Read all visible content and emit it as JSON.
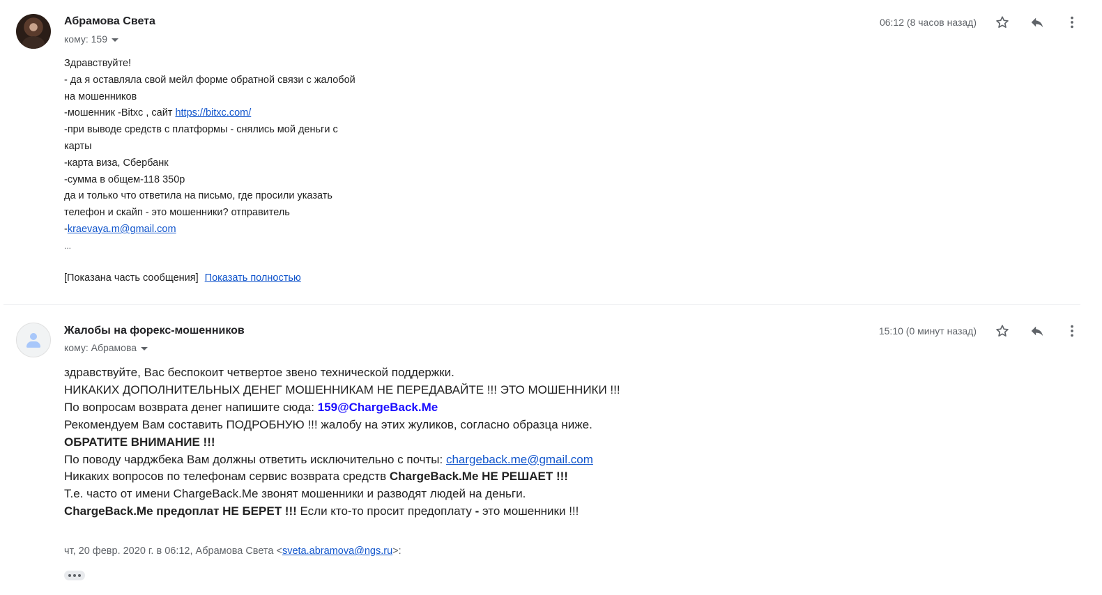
{
  "message1": {
    "sender": "Абрамова Света",
    "to": "кому: 159",
    "time": "06:12 (8 часов назад)",
    "body_lines": [
      "Здравствуйте!",
      "- да я оставляла свой мейл форме обратной связи с жалобой",
      "на мошенников"
    ],
    "fraud_prefix": "-мошенник -Bitxc , сайт ",
    "fraud_link": "https://bitxc.com/",
    "body_lines_2": [
      "-при выводе средств с платформы - снялись мой деньги с",
      "карты",
      "-карта виза, Сбербанк",
      "-сумма в общем-118 350р",
      "да и только что ответила на письмо, где просили указать",
      "телефон и скайп - это мошенники? отправитель"
    ],
    "sender_prefix": "-",
    "sender_email": "kraevaya.m@gmail.com",
    "ellipsis": "...",
    "trimmed_note": "[Показана часть сообщения]",
    "show_full": "Показать полностью"
  },
  "message2": {
    "sender": "Жалобы на форекс-мошенников",
    "to": "кому: Абрамова",
    "time": "15:10 (0 минут назад)",
    "line1": "здравствуйте, Вас беспокоит четвертое звено технической поддержки.",
    "line2": "НИКАКИХ ДОПОЛНИТЕЛЬНЫХ ДЕНЕГ МОШЕННИКАМ НЕ ПЕРЕДАВАЙТЕ !!! ЭТО МОШЕННИКИ !!!",
    "line3_text": "По вопросам возврата денег напишите сюда: ",
    "line3_email": "159@ChargeBack.Me",
    "line4": "Рекомендуем Вам составить ПОДРОБНУЮ !!! жалобу на этих жуликов, согласно образца ниже.",
    "line5": "ОБРАТИТЕ ВНИМАНИЕ !!!",
    "line6_text": "По поводу чарджбека Вам должны ответить исключительно с почты: ",
    "line6_email": "chargeback.me@gmail.com",
    "line7_text": "Никаких вопросов по телефонам сервис возврата средств ",
    "line7_bold": "ChargeBack.Me НЕ РЕШАЕТ !!!",
    "line8": "Т.е. часто от имени ChargeBack.Me звонят мошенники и разводят людей на деньги.",
    "line9_bold": "ChargeBack.Me предоплат НЕ БЕРЕТ !!!",
    "line9_text": " Если кто-то просит предоплату ",
    "line9_dash": "-",
    "line9_tail": " это мошенники !!!",
    "quote_prefix": "чт, 20 февр. 2020 г. в 06:12, Абрамова Света <",
    "quote_email": "sveta.abramova@ngs.ru",
    "quote_suffix": ">:"
  },
  "icons": {
    "star": "star-icon",
    "reply": "reply-icon",
    "more": "more-vert-icon"
  }
}
